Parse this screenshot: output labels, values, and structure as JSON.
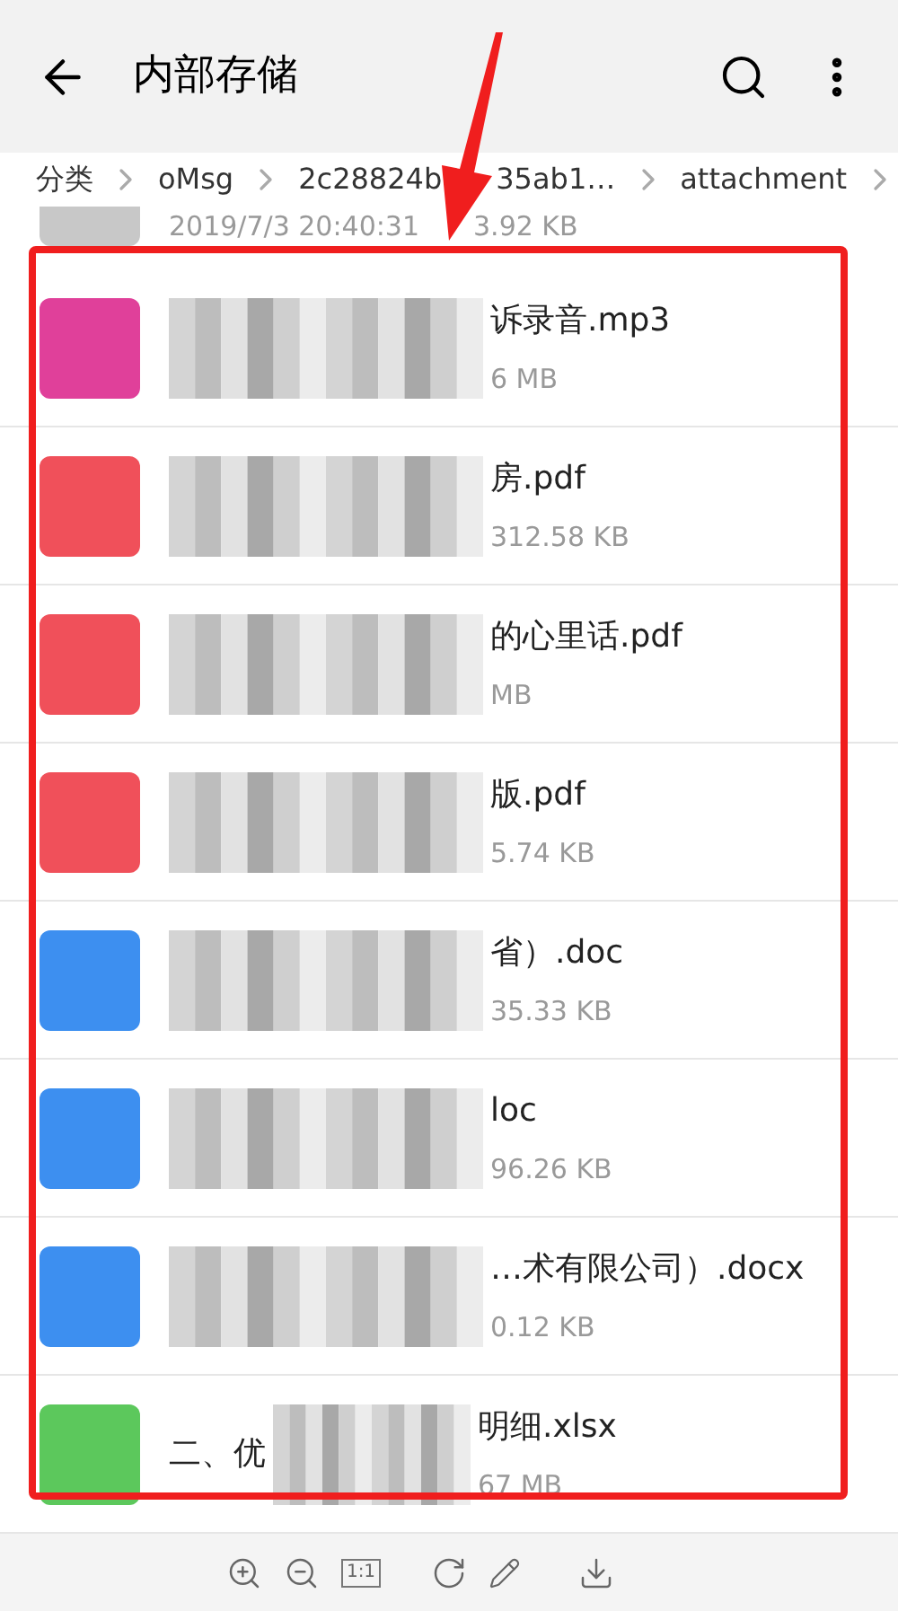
{
  "header": {
    "title": "内部存储"
  },
  "breadcrumb": [
    {
      "parts": [
        "分类"
      ]
    },
    {
      "parts": [
        "oMsg"
      ]
    },
    {
      "parts": [
        "2c28824b",
        "35ab1…"
      ]
    },
    {
      "parts": [
        "attachment"
      ]
    }
  ],
  "partial_row": {
    "kind": "other",
    "meta_parts": [
      "2019/7/3 20:40:31",
      "3.92 KB"
    ]
  },
  "files": [
    {
      "kind": "audio",
      "name": "诉录音.mp3",
      "meta": "6 MB"
    },
    {
      "kind": "pdf",
      "name": "房.pdf",
      "meta": "312.58 KB"
    },
    {
      "kind": "pdf",
      "name": "的心里话.pdf",
      "meta": "MB"
    },
    {
      "kind": "pdf",
      "name": "版.pdf",
      "meta": "5.74 KB"
    },
    {
      "kind": "doc",
      "name": "省）.doc",
      "meta": "35.33 KB"
    },
    {
      "kind": "doc",
      "name": "loc",
      "meta": "96.26 KB"
    },
    {
      "kind": "doc",
      "name": "…术有限公司）.docx",
      "meta": "0.12 KB"
    },
    {
      "kind": "sheet",
      "prefix": "二、优",
      "name": "明细.xlsx",
      "meta": "67 MB"
    }
  ],
  "viewer_toolbar": {
    "actual_size_label": "1:1"
  }
}
